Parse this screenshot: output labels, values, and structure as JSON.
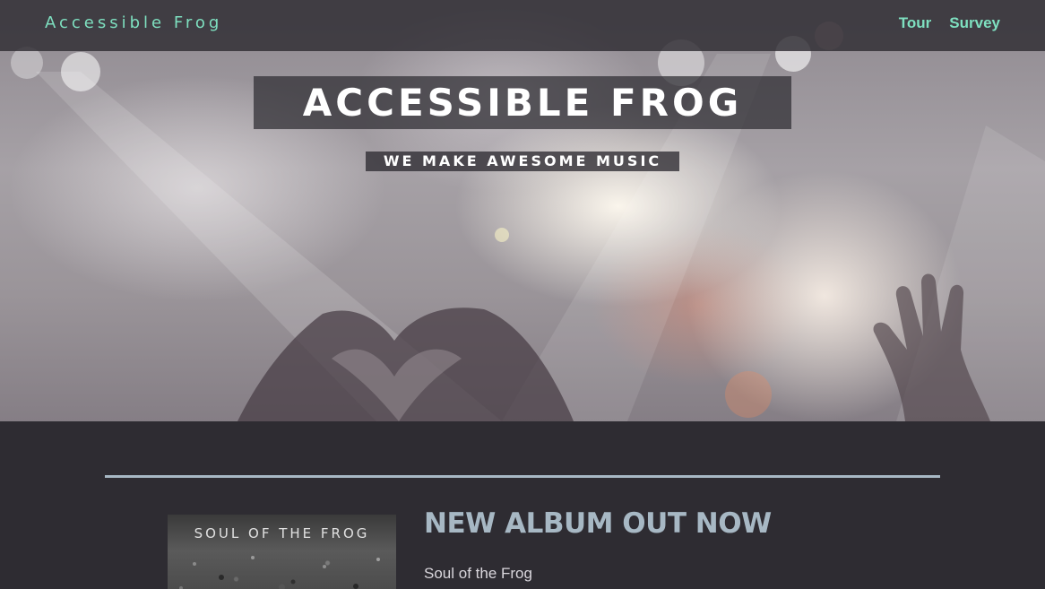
{
  "nav": {
    "brand": "Accessible Frog",
    "links": [
      {
        "label": "Tour"
      },
      {
        "label": "Survey"
      }
    ]
  },
  "hero": {
    "title": "ACCESSIBLE FROG",
    "subtitle": "WE MAKE AWESOME MUSIC"
  },
  "album_section": {
    "heading": "NEW ALBUM OUT NOW",
    "album_name": "Soul of the Frog",
    "cover_text": "SOUL OF THE FROG"
  },
  "colors": {
    "accent": "#7ee0c0",
    "heading": "#a7b8c4",
    "background": "#2e2c32"
  }
}
